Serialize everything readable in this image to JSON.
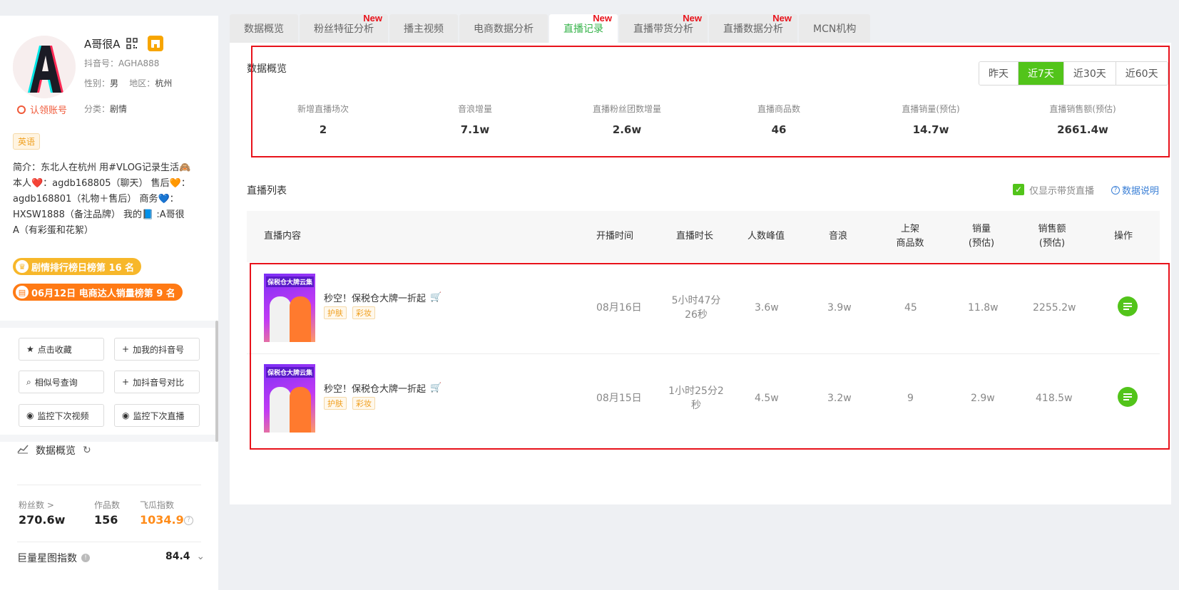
{
  "profile": {
    "name": "A哥很A",
    "douyin_id": "抖音号：AGHA888",
    "gender_label": "性别：",
    "gender": "男",
    "region_label": "地区：",
    "region": "杭州",
    "claim": "认领账号",
    "category_label": "分类：",
    "category": "剧情",
    "lang_tag": "英语",
    "intro_lines": [
      "简介：东北人在杭州 用#VLOG记录生活🙈",
      "本人❤️：agdb168805（聊天） 售后🧡：",
      "agdb168801（礼物＋售后） 商务💙：",
      "HXSW1888（备注品牌） 我的📘 :A哥很",
      "A（有彩蛋和花絮）"
    ],
    "rank1": "剧情排行榜日榜第 16 名",
    "rank2": "06月12日 电商达人销量榜第 9 名"
  },
  "actions": {
    "favorite": "点击收藏",
    "add_mine": "加我的抖音号",
    "similar": "相似号查询",
    "compare": "加抖音号对比",
    "monitor_video": "监控下次视频",
    "monitor_live": "监控下次直播"
  },
  "overview_side": {
    "title": "数据概览",
    "fans_label": "粉丝数 >",
    "fans": "270.6w",
    "works_label": "作品数",
    "works": "156",
    "fg_label": "飞瓜指数",
    "fg": "1034.9",
    "jl_label": "巨量星图指数",
    "jl": "84.4"
  },
  "tabs": [
    {
      "label": "数据概览",
      "new": false,
      "active": false
    },
    {
      "label": "粉丝特征分析",
      "new": true,
      "active": false
    },
    {
      "label": "播主视频",
      "new": false,
      "active": false
    },
    {
      "label": "电商数据分析",
      "new": false,
      "active": false
    },
    {
      "label": "直播记录",
      "new": true,
      "active": true
    },
    {
      "label": "直播带货分析",
      "new": true,
      "active": false
    },
    {
      "label": "直播数据分析",
      "new": true,
      "active": false
    },
    {
      "label": "MCN机构",
      "new": false,
      "active": false
    }
  ],
  "new_label": "New",
  "overview": {
    "title": "数据概览",
    "ranges": [
      "昨天",
      "近7天",
      "近30天",
      "近60天"
    ],
    "active_range": "近7天",
    "kpis": [
      {
        "label": "新增直播场次",
        "value": "2"
      },
      {
        "label": "音浪增量",
        "value": "7.1w"
      },
      {
        "label": "直播粉丝团数增量",
        "value": "2.6w"
      },
      {
        "label": "直播商品数",
        "value": "46"
      },
      {
        "label": "直播销量(预估)",
        "value": "14.7w"
      },
      {
        "label": "直播销售额(预估)",
        "value": "2661.4w"
      }
    ]
  },
  "live_list": {
    "title": "直播列表",
    "only_goods": "仅显示带货直播",
    "data_help": "数据说明",
    "headers": {
      "content": "直播内容",
      "start": "开播时间",
      "duration": "直播时长",
      "peak": "人数峰值",
      "yinlang": "音浪",
      "goods_1": "上架",
      "goods_2": "商品数",
      "sales_1": "销量",
      "sales_2": "(预估)",
      "gmv_1": "销售额",
      "gmv_2": "(预估)",
      "op": "操作"
    },
    "thumb_text": "保税仓大牌云集",
    "rows": [
      {
        "title": "秒空！保税仓大牌一折起",
        "tags": [
          "护肤",
          "彩妆"
        ],
        "start": "08月16日",
        "duration_1": "5小时47分",
        "duration_2": "26秒",
        "peak": "3.6w",
        "yinlang": "3.9w",
        "goods": "45",
        "sales": "11.8w",
        "gmv": "2255.2w"
      },
      {
        "title": "秒空！保税仓大牌一折起",
        "tags": [
          "护肤",
          "彩妆"
        ],
        "start": "08月15日",
        "duration_1": "1小时25分2",
        "duration_2": "秒",
        "peak": "4.5w",
        "yinlang": "3.2w",
        "goods": "9",
        "sales": "2.9w",
        "gmv": "418.5w"
      }
    ]
  },
  "colors": {
    "accent": "#52c41a",
    "new": "#e8121b",
    "highlight": "#e8121b",
    "orange": "#ff8c1a"
  }
}
